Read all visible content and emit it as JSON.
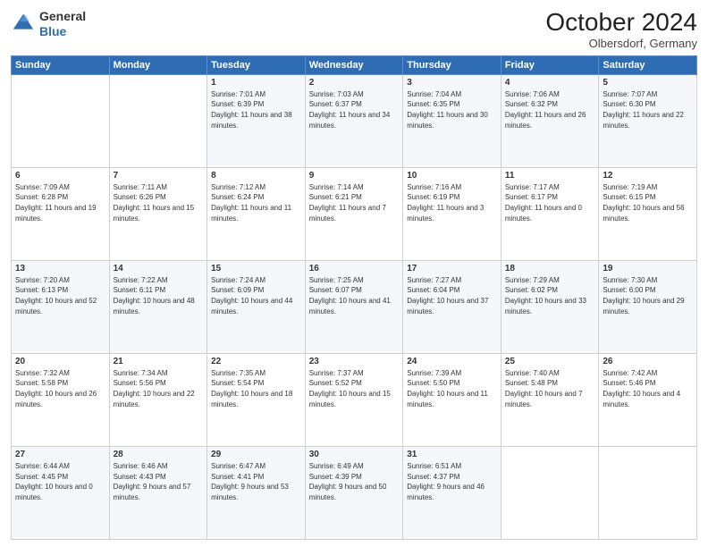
{
  "header": {
    "logo_general": "General",
    "logo_blue": "Blue",
    "month": "October 2024",
    "location": "Olbersdorf, Germany"
  },
  "weekdays": [
    "Sunday",
    "Monday",
    "Tuesday",
    "Wednesday",
    "Thursday",
    "Friday",
    "Saturday"
  ],
  "weeks": [
    [
      {
        "day": "",
        "info": ""
      },
      {
        "day": "",
        "info": ""
      },
      {
        "day": "1",
        "info": "Sunrise: 7:01 AM\nSunset: 6:39 PM\nDaylight: 11 hours and 38 minutes."
      },
      {
        "day": "2",
        "info": "Sunrise: 7:03 AM\nSunset: 6:37 PM\nDaylight: 11 hours and 34 minutes."
      },
      {
        "day": "3",
        "info": "Sunrise: 7:04 AM\nSunset: 6:35 PM\nDaylight: 11 hours and 30 minutes."
      },
      {
        "day": "4",
        "info": "Sunrise: 7:06 AM\nSunset: 6:32 PM\nDaylight: 11 hours and 26 minutes."
      },
      {
        "day": "5",
        "info": "Sunrise: 7:07 AM\nSunset: 6:30 PM\nDaylight: 11 hours and 22 minutes."
      }
    ],
    [
      {
        "day": "6",
        "info": "Sunrise: 7:09 AM\nSunset: 6:28 PM\nDaylight: 11 hours and 19 minutes."
      },
      {
        "day": "7",
        "info": "Sunrise: 7:11 AM\nSunset: 6:26 PM\nDaylight: 11 hours and 15 minutes."
      },
      {
        "day": "8",
        "info": "Sunrise: 7:12 AM\nSunset: 6:24 PM\nDaylight: 11 hours and 11 minutes."
      },
      {
        "day": "9",
        "info": "Sunrise: 7:14 AM\nSunset: 6:21 PM\nDaylight: 11 hours and 7 minutes."
      },
      {
        "day": "10",
        "info": "Sunrise: 7:16 AM\nSunset: 6:19 PM\nDaylight: 11 hours and 3 minutes."
      },
      {
        "day": "11",
        "info": "Sunrise: 7:17 AM\nSunset: 6:17 PM\nDaylight: 11 hours and 0 minutes."
      },
      {
        "day": "12",
        "info": "Sunrise: 7:19 AM\nSunset: 6:15 PM\nDaylight: 10 hours and 56 minutes."
      }
    ],
    [
      {
        "day": "13",
        "info": "Sunrise: 7:20 AM\nSunset: 6:13 PM\nDaylight: 10 hours and 52 minutes."
      },
      {
        "day": "14",
        "info": "Sunrise: 7:22 AM\nSunset: 6:11 PM\nDaylight: 10 hours and 48 minutes."
      },
      {
        "day": "15",
        "info": "Sunrise: 7:24 AM\nSunset: 6:09 PM\nDaylight: 10 hours and 44 minutes."
      },
      {
        "day": "16",
        "info": "Sunrise: 7:25 AM\nSunset: 6:07 PM\nDaylight: 10 hours and 41 minutes."
      },
      {
        "day": "17",
        "info": "Sunrise: 7:27 AM\nSunset: 6:04 PM\nDaylight: 10 hours and 37 minutes."
      },
      {
        "day": "18",
        "info": "Sunrise: 7:29 AM\nSunset: 6:02 PM\nDaylight: 10 hours and 33 minutes."
      },
      {
        "day": "19",
        "info": "Sunrise: 7:30 AM\nSunset: 6:00 PM\nDaylight: 10 hours and 29 minutes."
      }
    ],
    [
      {
        "day": "20",
        "info": "Sunrise: 7:32 AM\nSunset: 5:58 PM\nDaylight: 10 hours and 26 minutes."
      },
      {
        "day": "21",
        "info": "Sunrise: 7:34 AM\nSunset: 5:56 PM\nDaylight: 10 hours and 22 minutes."
      },
      {
        "day": "22",
        "info": "Sunrise: 7:35 AM\nSunset: 5:54 PM\nDaylight: 10 hours and 18 minutes."
      },
      {
        "day": "23",
        "info": "Sunrise: 7:37 AM\nSunset: 5:52 PM\nDaylight: 10 hours and 15 minutes."
      },
      {
        "day": "24",
        "info": "Sunrise: 7:39 AM\nSunset: 5:50 PM\nDaylight: 10 hours and 11 minutes."
      },
      {
        "day": "25",
        "info": "Sunrise: 7:40 AM\nSunset: 5:48 PM\nDaylight: 10 hours and 7 minutes."
      },
      {
        "day": "26",
        "info": "Sunrise: 7:42 AM\nSunset: 5:46 PM\nDaylight: 10 hours and 4 minutes."
      }
    ],
    [
      {
        "day": "27",
        "info": "Sunrise: 6:44 AM\nSunset: 4:45 PM\nDaylight: 10 hours and 0 minutes."
      },
      {
        "day": "28",
        "info": "Sunrise: 6:46 AM\nSunset: 4:43 PM\nDaylight: 9 hours and 57 minutes."
      },
      {
        "day": "29",
        "info": "Sunrise: 6:47 AM\nSunset: 4:41 PM\nDaylight: 9 hours and 53 minutes."
      },
      {
        "day": "30",
        "info": "Sunrise: 6:49 AM\nSunset: 4:39 PM\nDaylight: 9 hours and 50 minutes."
      },
      {
        "day": "31",
        "info": "Sunrise: 6:51 AM\nSunset: 4:37 PM\nDaylight: 9 hours and 46 minutes."
      },
      {
        "day": "",
        "info": ""
      },
      {
        "day": "",
        "info": ""
      }
    ]
  ]
}
